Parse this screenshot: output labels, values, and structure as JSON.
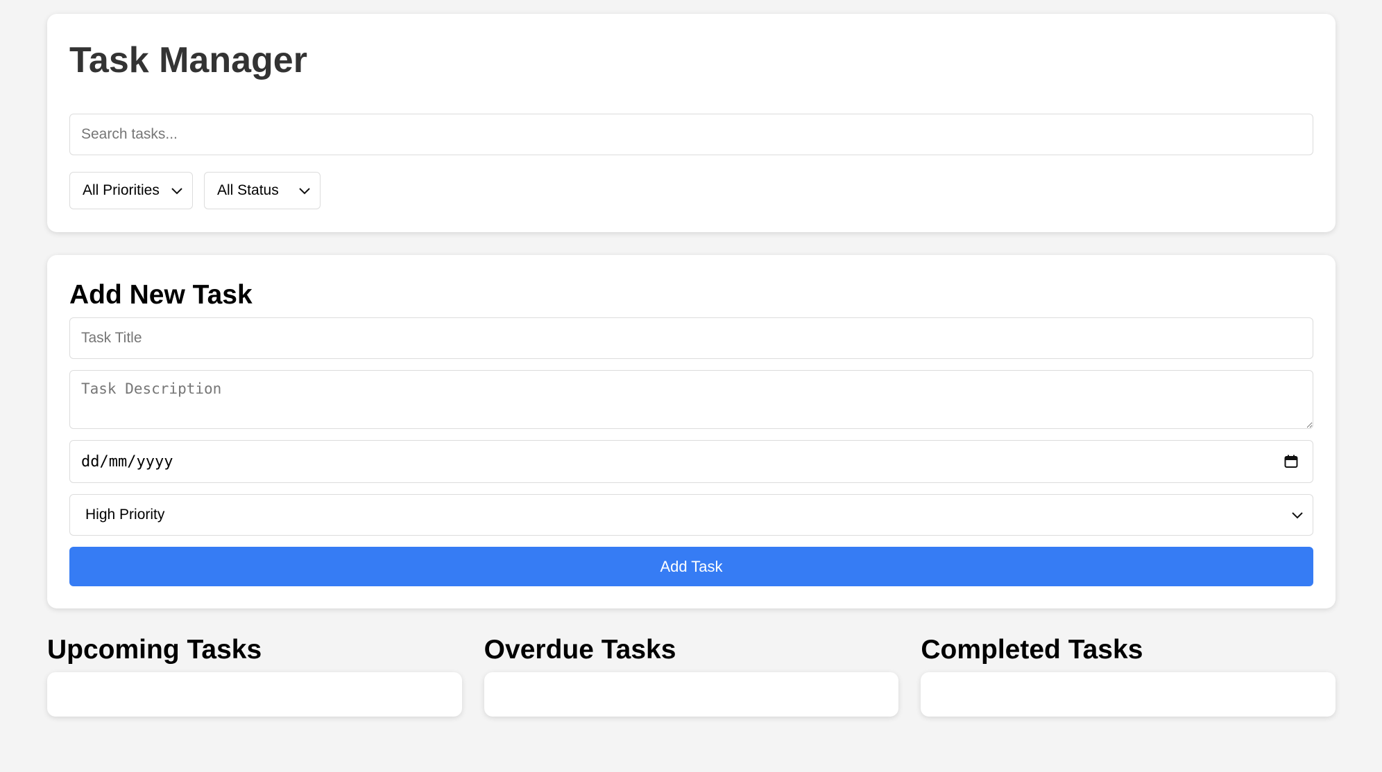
{
  "header": {
    "title": "Task Manager",
    "search_placeholder": "Search tasks...",
    "filters": {
      "priority_selected": "All Priorities",
      "status_selected": "All Status"
    }
  },
  "form": {
    "title": "Add New Task",
    "title_placeholder": "Task Title",
    "description_placeholder": "Task Description",
    "date_placeholder": "dd/mm/yyyy",
    "priority_selected": "High Priority",
    "submit_label": "Add Task"
  },
  "columns": [
    {
      "title": "Upcoming Tasks"
    },
    {
      "title": "Overdue Tasks"
    },
    {
      "title": "Completed Tasks"
    }
  ],
  "colors": {
    "accent": "#367cf4",
    "background": "#f4f4f4",
    "card": "#ffffff",
    "title_text": "#333333"
  },
  "icons": {
    "dropdown": "chevron-down-icon",
    "date": "calendar-icon"
  }
}
